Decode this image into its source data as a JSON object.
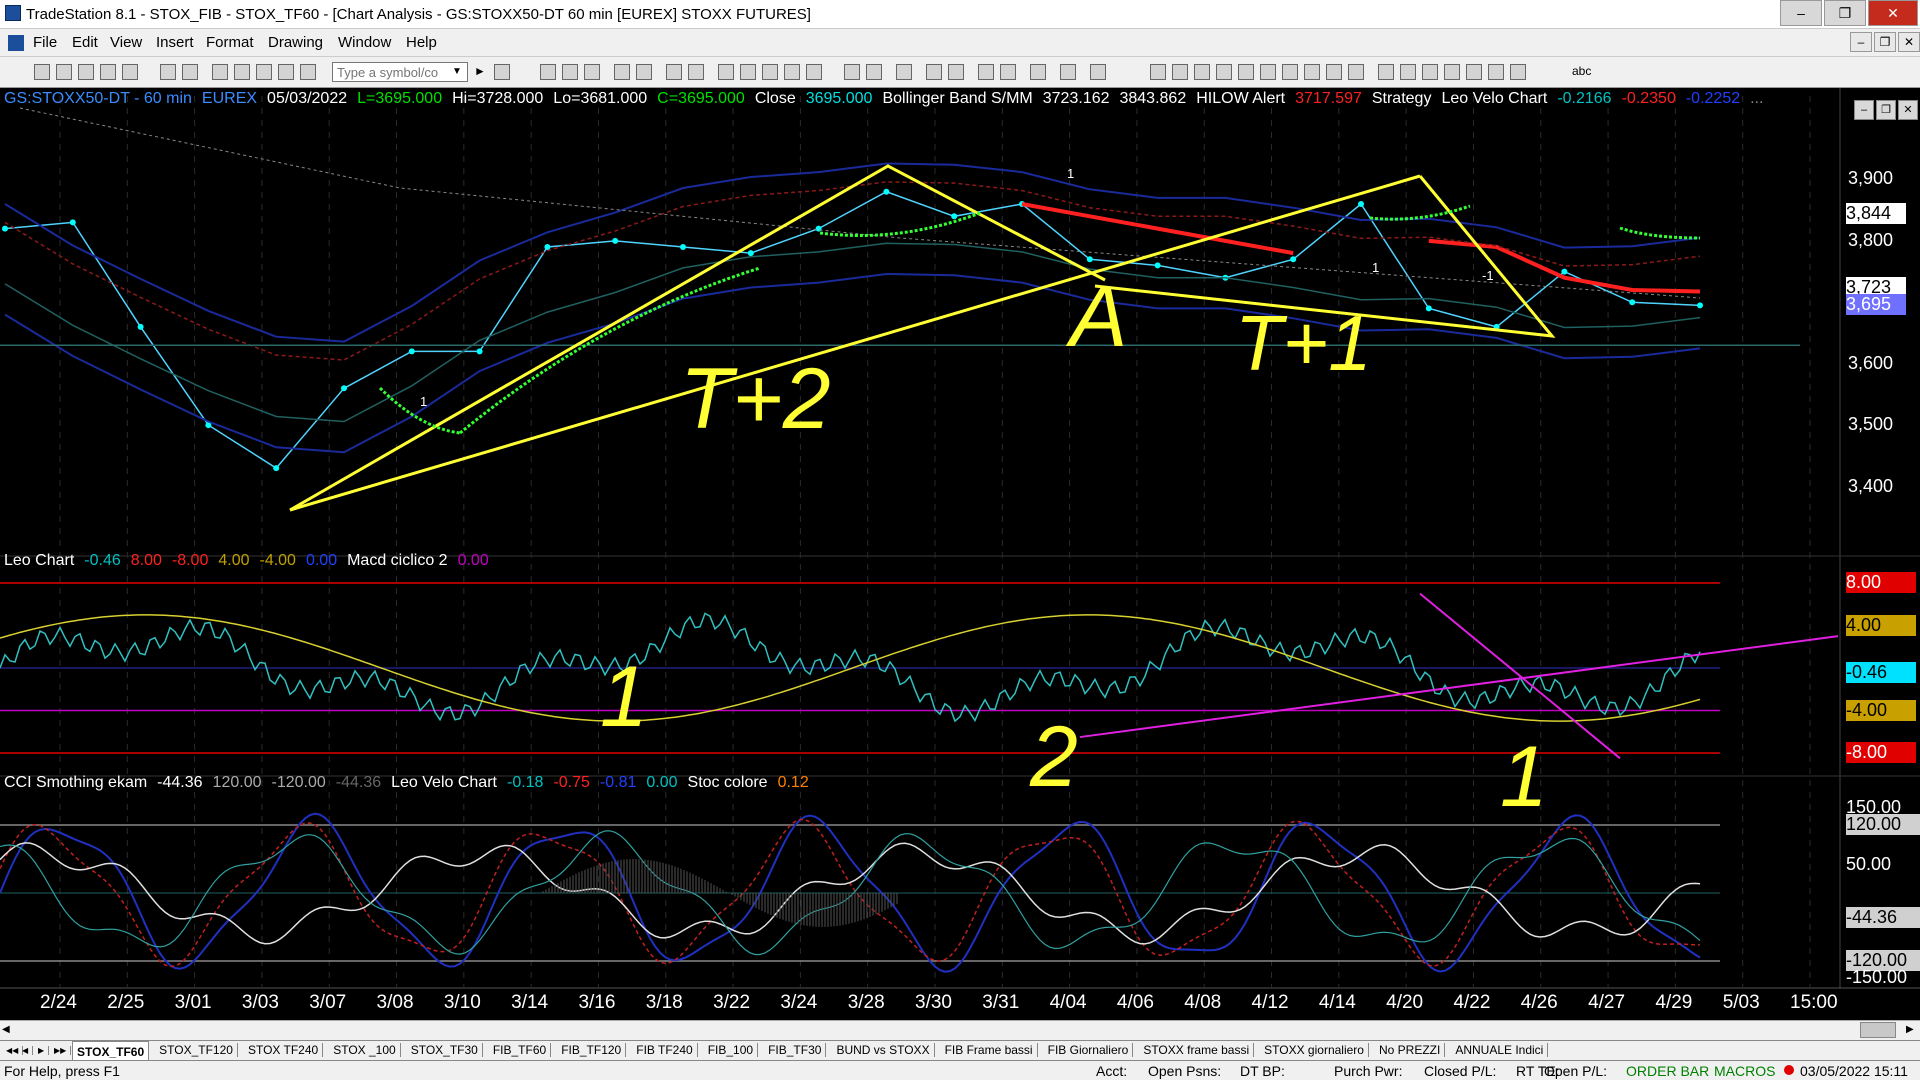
{
  "window": {
    "title": "TradeStation 8.1 - STOX_FIB - STOX_TF60 - [Chart Analysis - GS:STOXX50-DT  60 min  [EUREX] STOXX FUTURES]",
    "minimize": "–",
    "restore": "❐",
    "close": "✕"
  },
  "menu": {
    "items": [
      "File",
      "Edit",
      "View",
      "Insert",
      "Format",
      "Drawing",
      "Window",
      "Help"
    ],
    "mdi_minimize": "–",
    "mdi_restore": "❐",
    "mdi_close": "✕"
  },
  "toolbar": {
    "symbol_placeholder": "Type a symbol/co",
    "abc_label": "abc"
  },
  "chart": {
    "main_header": [
      {
        "text": "GS:STOXX50-DT - 60 min",
        "color": "#3b8cff"
      },
      {
        "text": "EUREX",
        "color": "#3b8cff"
      },
      {
        "text": "05/03/2022",
        "color": "#ffffff"
      },
      {
        "text": "L=3695.000",
        "color": "#00e000"
      },
      {
        "text": "Hi=3728.000",
        "color": "#ffffff"
      },
      {
        "text": "Lo=3681.000",
        "color": "#ffffff"
      },
      {
        "text": "C=3695.000",
        "color": "#00e000"
      },
      {
        "text": "Close",
        "color": "#ffffff"
      },
      {
        "text": "3695.000",
        "color": "#00e0e0"
      },
      {
        "text": "Bollinger Band S/MM",
        "color": "#ffffff"
      },
      {
        "text": "3723.162",
        "color": "#ffffff"
      },
      {
        "text": "3843.862",
        "color": "#ffffff"
      },
      {
        "text": "HILOW Alert",
        "color": "#ffffff"
      },
      {
        "text": "3717.597",
        "color": "#ff2020"
      },
      {
        "text": "Strategy",
        "color": "#ffffff"
      },
      {
        "text": "Leo Velo Chart",
        "color": "#ffffff"
      },
      {
        "text": "-0.2166",
        "color": "#00c0c0"
      },
      {
        "text": "-0.2350",
        "color": "#ff2020"
      },
      {
        "text": "-0.2252",
        "color": "#2040ff"
      },
      {
        "text": "...",
        "color": "#888888"
      }
    ],
    "leo_header": [
      {
        "text": "Leo Chart",
        "color": "#ffffff"
      },
      {
        "text": "-0.46",
        "color": "#00c0c0"
      },
      {
        "text": "8.00",
        "color": "#ff2020"
      },
      {
        "text": "-8.00",
        "color": "#ff2020"
      },
      {
        "text": "4.00",
        "color": "#c0a000"
      },
      {
        "text": "-4.00",
        "color": "#c0a000"
      },
      {
        "text": "0.00",
        "color": "#2040ff"
      },
      {
        "text": "Macd ciclico 2",
        "color": "#ffffff"
      },
      {
        "text": "0.00",
        "color": "#c000c0"
      }
    ],
    "cci_header": [
      {
        "text": "CCI Smothing ekam",
        "color": "#ffffff"
      },
      {
        "text": "-44.36",
        "color": "#ffffff"
      },
      {
        "text": "120.00",
        "color": "#aaaaaa"
      },
      {
        "text": "-120.00",
        "color": "#aaaaaa"
      },
      {
        "text": "-44.36",
        "color": "#666666"
      },
      {
        "text": "Leo Velo Chart",
        "color": "#ffffff"
      },
      {
        "text": "-0.18",
        "color": "#00c0c0"
      },
      {
        "text": "-0.75",
        "color": "#ff2020"
      },
      {
        "text": "-0.81",
        "color": "#2040ff"
      },
      {
        "text": "0.00",
        "color": "#00c0c0"
      },
      {
        "text": "Stoc colore",
        "color": "#ffffff"
      },
      {
        "text": "0.12",
        "color": "#ff8000"
      }
    ],
    "price_axis": [
      {
        "label": "3,900",
        "value": 3900
      },
      {
        "label": "3,800",
        "value": 3800
      },
      {
        "label": "3,600",
        "value": 3600
      },
      {
        "label": "3,500",
        "value": 3500
      },
      {
        "label": "3,400",
        "value": 3400
      }
    ],
    "price_markers": [
      {
        "label": "3,844",
        "value": 3844,
        "bg": "#ffffff",
        "fg": "#000000"
      },
      {
        "label": "3,723",
        "value": 3723,
        "bg": "#ffffff",
        "fg": "#000000"
      },
      {
        "label": "3,695",
        "value": 3695,
        "bg": "#7070ff",
        "fg": "#ffffff"
      }
    ],
    "leo_axis": [
      {
        "label": "8.00",
        "value": 8,
        "bg": "#e00000",
        "fg": "#ffffff"
      },
      {
        "label": "4.00",
        "value": 4,
        "bg": "#c8a000",
        "fg": "#000000"
      },
      {
        "label": "-0.46",
        "value": -0.46,
        "bg": "#00e0ff",
        "fg": "#000000"
      },
      {
        "label": "-4.00",
        "value": -4,
        "bg": "#c8a000",
        "fg": "#000000"
      },
      {
        "label": "-8.00",
        "value": -8,
        "bg": "#e00000",
        "fg": "#ffffff"
      }
    ],
    "cci_axis": [
      {
        "label": "150.00",
        "value": 150,
        "bg": "",
        "fg": "#ffffff"
      },
      {
        "label": "120.00",
        "value": 120,
        "bg": "#d0d0d0",
        "fg": "#000000"
      },
      {
        "label": "50.00",
        "value": 50,
        "bg": "",
        "fg": "#ffffff"
      },
      {
        "label": "-44.36",
        "value": -44.36,
        "bg": "#d0d0d0",
        "fg": "#000000"
      },
      {
        "label": "-120.00",
        "value": -120,
        "bg": "#d0d0d0",
        "fg": "#000000"
      },
      {
        "label": "-150.00",
        "value": -150,
        "bg": "",
        "fg": "#ffffff"
      }
    ],
    "time_axis": [
      "2/24",
      "2/25",
      "3/01",
      "3/03",
      "3/07",
      "3/08",
      "3/10",
      "3/14",
      "3/16",
      "3/18",
      "3/22",
      "3/24",
      "3/28",
      "3/30",
      "3/31",
      "4/04",
      "4/06",
      "4/08",
      "4/12",
      "4/14",
      "4/20",
      "4/22",
      "4/26",
      "4/27",
      "4/29",
      "5/03",
      "15:00"
    ],
    "annotations": {
      "t2": "T+2",
      "a": "A",
      "t1": "T+1",
      "n1": "1",
      "n2": "2",
      "n1b": "1",
      "marker_1a": "1",
      "marker_1b": "1",
      "marker_m1": "-1",
      "marker_1c": "1"
    }
  },
  "chart_data": {
    "type": "line",
    "title": "GS:STOXX50-DT - 60 min",
    "x": [
      "2/24",
      "2/25",
      "3/01",
      "3/03",
      "3/07",
      "3/08",
      "3/10",
      "3/14",
      "3/16",
      "3/18",
      "3/22",
      "3/24",
      "3/28",
      "3/30",
      "3/31",
      "4/04",
      "4/06",
      "4/08",
      "4/12",
      "4/14",
      "4/20",
      "4/22",
      "4/26",
      "4/27",
      "4/29",
      "5/03"
    ],
    "series": [
      {
        "name": "Close",
        "values": [
          3820,
          3830,
          3660,
          3500,
          3430,
          3560,
          3620,
          3620,
          3790,
          3800,
          3790,
          3780,
          3820,
          3880,
          3840,
          3860,
          3770,
          3760,
          3740,
          3770,
          3860,
          3690,
          3660,
          3750,
          3700,
          3695
        ]
      },
      {
        "name": "HILOW Alert",
        "values": [
          null,
          null,
          null,
          null,
          null,
          null,
          null,
          null,
          null,
          null,
          null,
          null,
          null,
          null,
          null,
          3860,
          3840,
          3820,
          3800,
          3780,
          null,
          3800,
          3790,
          3740,
          3720,
          3717.597
        ]
      }
    ],
    "ylim": [
      3300,
      4000
    ],
    "grid": true,
    "legend": "top-left"
  },
  "tabs": [
    "STOX_TF60",
    "STOX_TF120",
    "STOX TF240",
    "STOX _100",
    "STOX_TF30",
    "FIB_TF60",
    "FIB_TF120",
    "FIB TF240",
    "FIB_100",
    "FIB_TF30",
    "BUND vs STOXX",
    "FIB Frame bassi",
    "FIB Giornaliero",
    "STOXX frame bassi",
    "STOXX giornaliero",
    "No PREZZI",
    "ANNUALE Indici"
  ],
  "status": {
    "help": "For Help, press F1",
    "acct": "Acct:",
    "open_psns": "Open Psns:",
    "dt_bp": "DT BP:",
    "purch_pwr": "Purch Pwr:",
    "closed_pl": "Closed P/L:",
    "rt_te": "RT TE:",
    "open_pl": "Open P/L:",
    "order_bar": "ORDER BAR",
    "macros": "MACROS",
    "datetime": "03/05/2022 15:11"
  }
}
